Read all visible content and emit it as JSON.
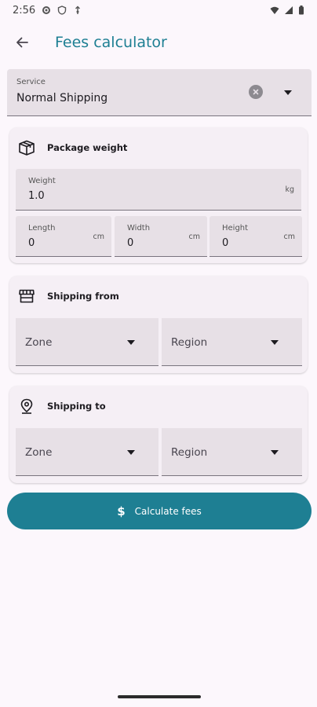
{
  "status_bar": {
    "time": "2:56",
    "icons": [
      "settings-icon",
      "shield-icon",
      "vpn-key-icon",
      "wifi-icon",
      "signal-icon",
      "battery-icon"
    ]
  },
  "app_bar": {
    "title": "Fees calculator",
    "back_icon": "arrow-left-icon"
  },
  "service": {
    "label": "Service",
    "value": "Normal Shipping"
  },
  "package_weight": {
    "title": "Package weight",
    "icon": "package-icon",
    "weight": {
      "label": "Weight",
      "value": "1.0",
      "unit": "kg"
    },
    "length": {
      "label": "Length",
      "value": "0",
      "unit": "cm"
    },
    "width": {
      "label": "Width",
      "value": "0",
      "unit": "cm"
    },
    "height": {
      "label": "Height",
      "value": "0",
      "unit": "cm"
    }
  },
  "shipping_from": {
    "title": "Shipping from",
    "icon": "storefront-icon",
    "zone": "Zone",
    "region": "Region"
  },
  "shipping_to": {
    "title": "Shipping to",
    "icon": "location-pin-icon",
    "zone": "Zone",
    "region": "Region"
  },
  "calculate_button": {
    "label": "Calculate fees",
    "icon": "dollar-icon"
  },
  "colors": {
    "accent": "#1e7f93",
    "background": "#fcf7fc",
    "field": "#e7e0e6",
    "card": "#f5eff5"
  }
}
